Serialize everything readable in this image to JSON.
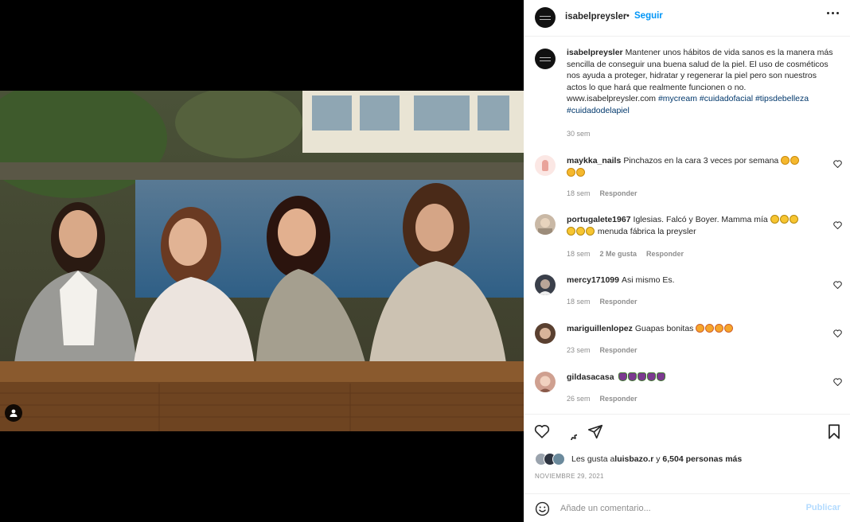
{
  "post": {
    "username": "isabelpreysler",
    "follow_label": "Seguir",
    "separator": "•",
    "caption_text": "Mantener unos hábitos de vida sanos es la manera más sencilla de conseguir una buena salud de la piel. El uso de cosméticos nos ayuda a proteger, hidratar y regenerar la piel pero son nuestros actos lo que hará que realmente funcionen o no. www.isabelpreysler.com ",
    "caption_hashtags": "#mycream #cuidadofacial #tipsdebelleza #cuidadodelapiel",
    "caption_time": "30 sem"
  },
  "comments": [
    {
      "user": "maykka_nails",
      "text": "Pinchazos en la cara 3 veces por semana",
      "emoji": "clap",
      "emoji_count": 4,
      "time": "18 sem",
      "likes": "",
      "reply": "Responder"
    },
    {
      "user": "portugalete1967",
      "text": "Iglesias. Falcó y Boyer. Mamma mía",
      "emoji": "laugh",
      "emoji_count": 6,
      "tail": " menuda fábrica la preysler",
      "time": "18 sem",
      "likes": "2 Me gusta",
      "reply": "Responder"
    },
    {
      "user": "mercy171099",
      "text": "Asi mismo Es.",
      "emoji": "",
      "emoji_count": 0,
      "time": "18 sem",
      "likes": "",
      "reply": "Responder"
    },
    {
      "user": "mariguillenlopez",
      "text": "Guapas bonitas",
      "emoji": "star",
      "emoji_count": 4,
      "time": "23 sem",
      "likes": "",
      "reply": "Responder"
    },
    {
      "user": "gildasacasa",
      "text": "",
      "emoji": "tulip",
      "emoji_count": 5,
      "time": "26 sem",
      "likes": "",
      "reply": "Responder"
    }
  ],
  "likes_info": {
    "prefix": "Les gusta a ",
    "first_user": "luisbazo.r",
    "middle": " y ",
    "others": "6,504 personas más"
  },
  "date": "NOVIEMBRE 29, 2021",
  "comment_box": {
    "placeholder": "Añade un comentario...",
    "publish_label": "Publicar"
  },
  "icons": {
    "more": "more-options-icon",
    "like": "heart-icon",
    "comment": "comment-icon",
    "share": "share-icon",
    "save": "bookmark-icon",
    "emoji": "emoji-icon",
    "tag": "user-tag-icon"
  },
  "colors": {
    "accent": "#0095f6",
    "hashtag": "#00376b",
    "muted": "#8e8e8e",
    "publish_disabled": "#b3dbff"
  }
}
